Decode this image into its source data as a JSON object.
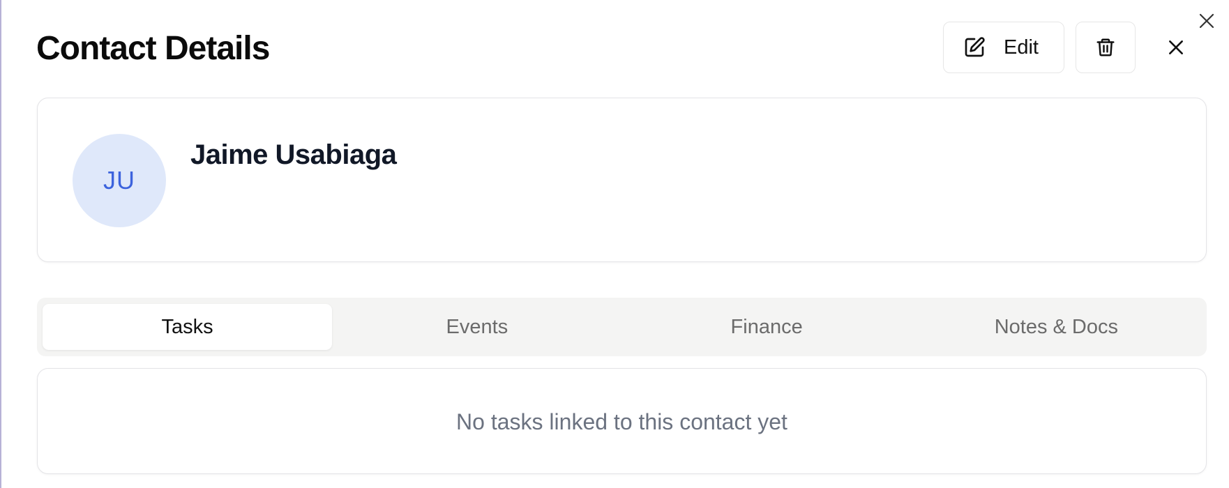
{
  "dialog": {
    "title": "Contact Details",
    "edit_label": "Edit"
  },
  "contact": {
    "initials": "JU",
    "name": "Jaime Usabiaga"
  },
  "tabs": [
    {
      "label": "Tasks",
      "active": true
    },
    {
      "label": "Events",
      "active": false
    },
    {
      "label": "Finance",
      "active": false
    },
    {
      "label": "Notes & Docs",
      "active": false
    }
  ],
  "tasks_panel": {
    "empty_message": "No tasks linked to this contact yet"
  },
  "icons": {
    "outer_close": "close-icon",
    "edit": "pencil-square-icon",
    "delete": "trash-icon",
    "dialog_close": "close-icon"
  },
  "colors": {
    "avatar_bg": "#dfe8fa",
    "avatar_text": "#3c63dd",
    "tab_bar_bg": "#f4f4f3",
    "muted_text": "#6b7280"
  }
}
